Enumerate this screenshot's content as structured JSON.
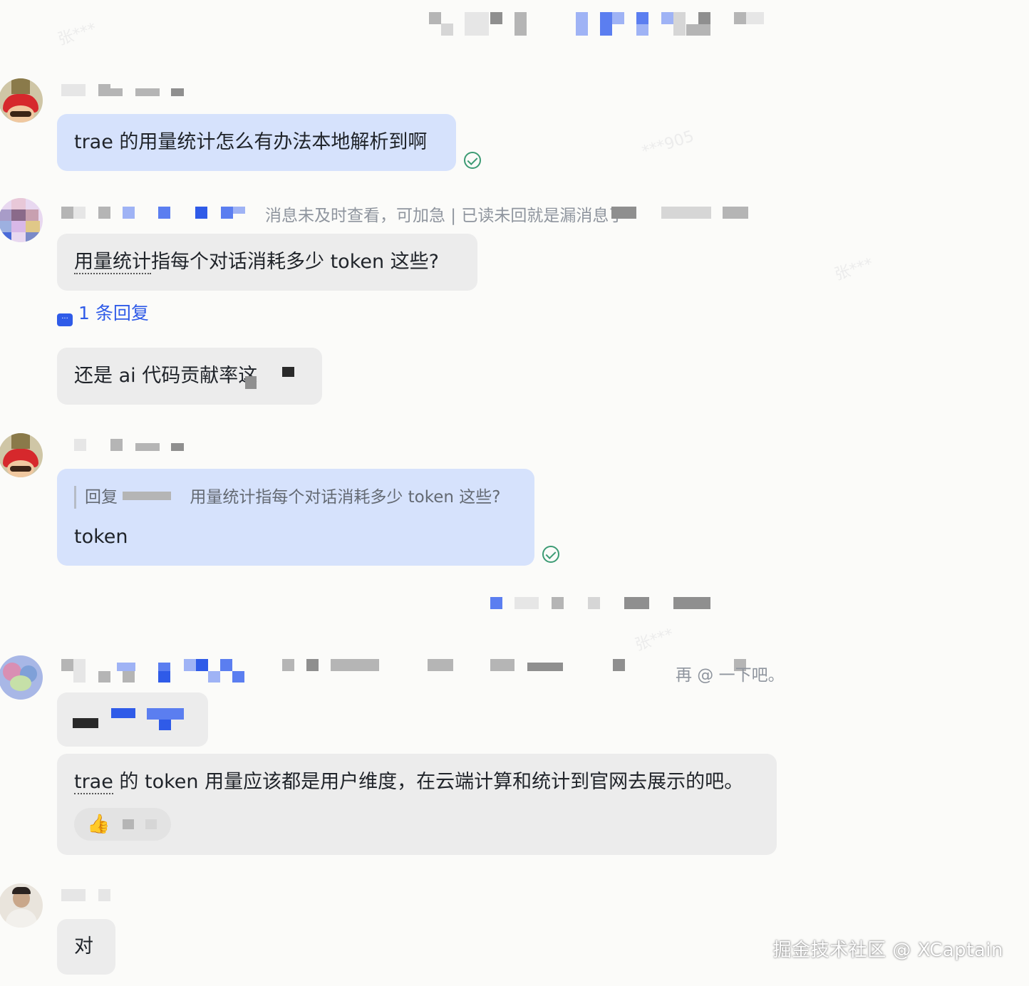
{
  "messages": {
    "m1": {
      "text": "trae 的用量统计怎么有办法本地解析到啊"
    },
    "m2": {
      "text_underlined": "用量统计",
      "text_rest": "指每个对话消耗多少 token 这些?",
      "reply_count": "1 条回复"
    },
    "m3": {
      "text": "还是 ai 代码贡献率这"
    },
    "m4": {
      "quote_prefix": "回复 ",
      "quote_text": "用量统计指每个对话消耗多少 token 这些?",
      "text": "token"
    },
    "m6": {
      "text_underlined": "trae",
      "text_rest": " 的 token 用量应该都是用户维度，在云端计算和统计到官网去展示的吧。"
    },
    "m7": {
      "text": "对"
    }
  },
  "notices": {
    "n1": "消息未及时查看，可加急 | 已读未回就是漏消息了",
    "n2": "再 @ 一下吧。"
  },
  "watermark": "掘金技术社区 @ XCaptain",
  "colors": {
    "accent": "#2f5be8",
    "my_bubble": "#d6e2fc",
    "other_bubble": "#ececec",
    "read_check": "#3c9b74"
  },
  "icons": {
    "read": "check-circle-icon",
    "reply": "chat-bubble-icon",
    "reaction": "thumbs-up-icon"
  }
}
